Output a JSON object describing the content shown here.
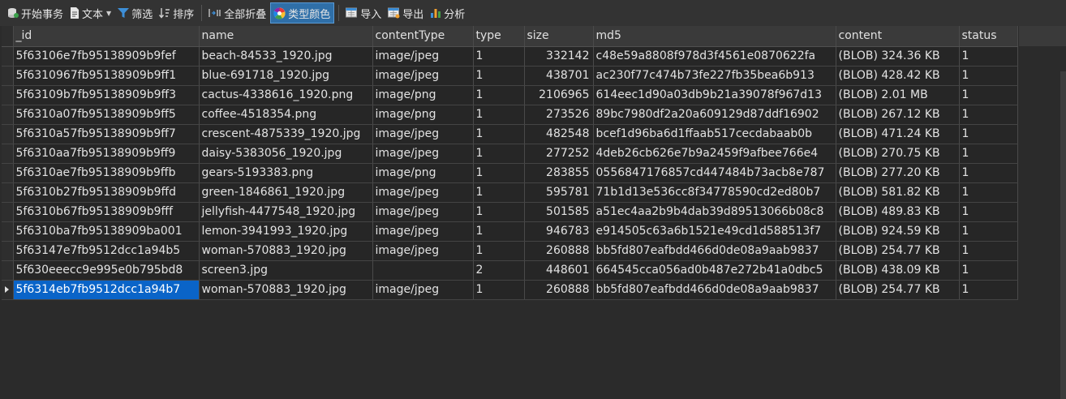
{
  "toolbar": {
    "begin_transaction": "开始事务",
    "text": "文本",
    "filter": "筛选",
    "sort": "排序",
    "collapse_all": "全部折叠",
    "type_color": "类型颜色",
    "import": "导入",
    "export": "导出",
    "analyze": "分析"
  },
  "columns": [
    "_id",
    "name",
    "contentType",
    "type",
    "size",
    "md5",
    "content",
    "status"
  ],
  "rows": [
    [
      "5f63106e7fb95138909b9fef",
      "beach-84533_1920.jpg",
      "image/jpeg",
      "1",
      "332142",
      "c48e59a8808f978d3f4561e0870622fa",
      "(BLOB) 324.36 KB",
      "1"
    ],
    [
      "5f6310967fb95138909b9ff1",
      "blue-691718_1920.jpg",
      "image/jpeg",
      "1",
      "438701",
      "ac230f77c474b73fe227fb35bea6b913",
      "(BLOB) 428.42 KB",
      "1"
    ],
    [
      "5f63109b7fb95138909b9ff3",
      "cactus-4338616_1920.png",
      "image/png",
      "1",
      "2106965",
      "614eec1d90a03db9b21a39078f967d13",
      "(BLOB) 2.01 MB",
      "1"
    ],
    [
      "5f6310a07fb95138909b9ff5",
      "coffee-4518354.png",
      "image/png",
      "1",
      "273526",
      "89bc7980df2a20a609129d87ddf16902",
      "(BLOB) 267.12 KB",
      "1"
    ],
    [
      "5f6310a57fb95138909b9ff7",
      "crescent-4875339_1920.jpg",
      "image/jpeg",
      "1",
      "482548",
      "bcef1d96ba6d1ffaab517cecdabaab0b",
      "(BLOB) 471.24 KB",
      "1"
    ],
    [
      "5f6310aa7fb95138909b9ff9",
      "daisy-5383056_1920.jpg",
      "image/jpeg",
      "1",
      "277252",
      "4deb26cb626e7b9a2459f9afbee766e4",
      "(BLOB) 270.75 KB",
      "1"
    ],
    [
      "5f6310ae7fb95138909b9ffb",
      "gears-5193383.png",
      "image/png",
      "1",
      "283855",
      "0556847176857cd447484b73acb8e787",
      "(BLOB) 277.20 KB",
      "1"
    ],
    [
      "5f6310b27fb95138909b9ffd",
      "green-1846861_1920.jpg",
      "image/jpeg",
      "1",
      "595781",
      "71b1d13e536cc8f34778590cd2ed80b7",
      "(BLOB) 581.82 KB",
      "1"
    ],
    [
      "5f6310b67fb95138909b9fff",
      "jellyfish-4477548_1920.jpg",
      "image/jpeg",
      "1",
      "501585",
      "a51ec4aa2b9b4dab39d89513066b08c8",
      "(BLOB) 489.83 KB",
      "1"
    ],
    [
      "5f6310ba7fb95138909ba001",
      "lemon-3941993_1920.jpg",
      "image/jpeg",
      "1",
      "946783",
      "e914505c63a6b1521e49cd1d588513f7",
      "(BLOB) 924.59 KB",
      "1"
    ],
    [
      "5f63147e7fb9512dcc1a94b5",
      "woman-570883_1920.jpg",
      "image/jpeg",
      "1",
      "260888",
      "bb5fd807eafbdd466d0de08a9aab9837",
      "(BLOB) 254.77 KB",
      "1"
    ],
    [
      "5f630eeecc9e995e0b795bd8",
      "screen3.jpg",
      "",
      "2",
      "448601",
      "664545cca056ad0b487e272b41a0dbc5",
      "(BLOB) 438.09 KB",
      "1"
    ],
    [
      "5f6314eb7fb9512dcc1a94b7",
      "woman-570883_1920.jpg",
      "image/jpeg",
      "1",
      "260888",
      "bb5fd807eafbdd466d0de08a9aab9837",
      "(BLOB) 254.77 KB",
      "1"
    ]
  ],
  "current_row_index": 12,
  "colors": {
    "selection": "#0a64c8",
    "toolbar_active": "#2f6fa8",
    "background": "#2b2b2b"
  }
}
